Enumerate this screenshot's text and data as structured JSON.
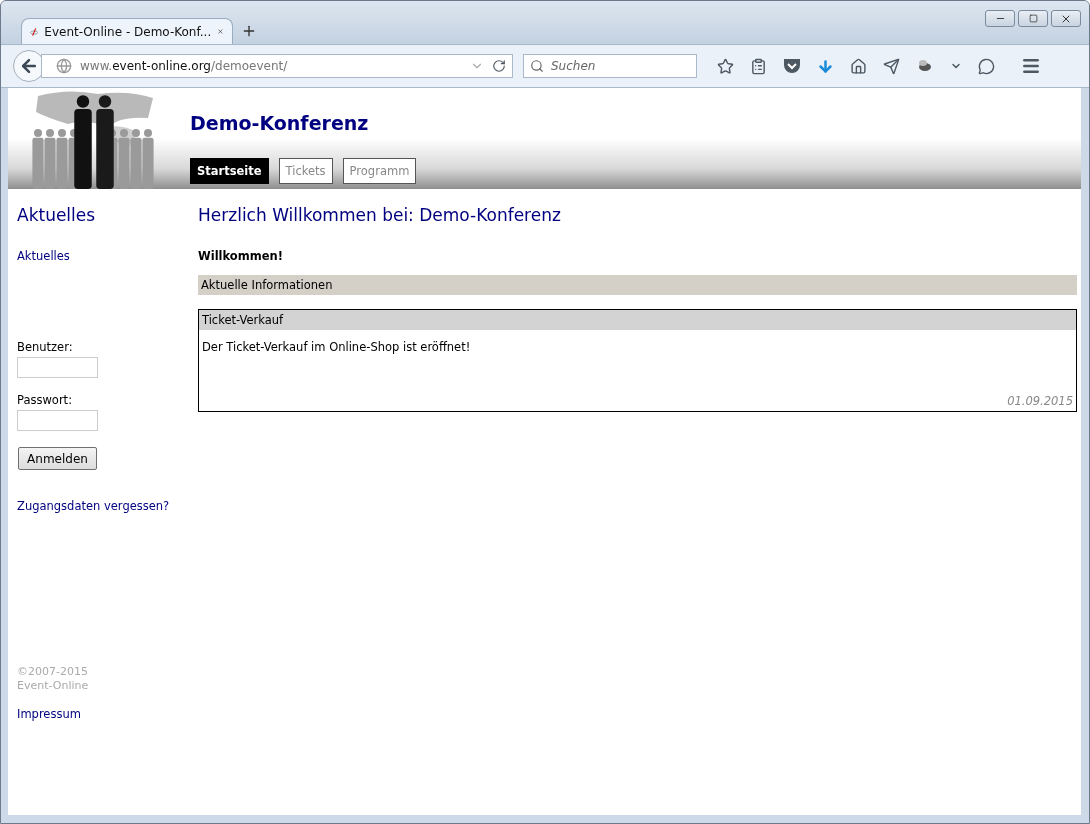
{
  "browser": {
    "tab": {
      "title": "Event-Online - Demo-Konf...",
      "selected": true
    },
    "address": {
      "prefix": "www.",
      "domain": "event-online.org",
      "path": "/demoevent/"
    },
    "search": {
      "placeholder": "Suchen"
    }
  },
  "site": {
    "title": "Demo-Konferenz",
    "nav": [
      {
        "label": "Startseite",
        "selected": true
      },
      {
        "label": "Tickets",
        "selected": false
      },
      {
        "label": "Programm",
        "selected": false
      }
    ]
  },
  "sidebar": {
    "heading": "Aktuelles",
    "links": [
      "Aktuelles"
    ],
    "login": {
      "user_label": "Benutzer:",
      "password_label": "Passwort:",
      "button": "Anmelden",
      "forgot": "Zugangsdaten vergessen?"
    },
    "copyright": [
      "©2007-2015",
      "Event-Online"
    ],
    "impressum": "Impressum"
  },
  "main": {
    "heading": "Herzlich Willkommen bei: Demo-Konferenz",
    "intro": "Willkommen!",
    "section": "Aktuelle Informationen",
    "news": [
      {
        "title": "Ticket-Verkauf",
        "text": "Der Ticket-Verkauf im Online-Shop ist eröffnet!",
        "date": "01.09.2015"
      }
    ]
  }
}
